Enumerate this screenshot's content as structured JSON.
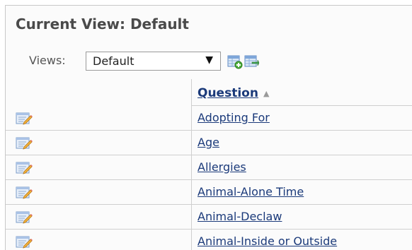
{
  "title": "Current View: Default",
  "views": {
    "label": "Views:",
    "selected": "Default",
    "dropdown_arrow": "▼"
  },
  "toolbar": {
    "icons": [
      "new-view-icon",
      "edit-view-icon"
    ]
  },
  "table": {
    "column_header": "Question",
    "sort_indicator": "▲",
    "row_icon": "edit-document-icon",
    "rows": [
      {
        "question": "Adopting For"
      },
      {
        "question": "Age"
      },
      {
        "question": "Allergies"
      },
      {
        "question": "Animal-Alone Time"
      },
      {
        "question": "Animal-Declaw"
      },
      {
        "question": "Animal-Inside or Outside"
      }
    ]
  }
}
